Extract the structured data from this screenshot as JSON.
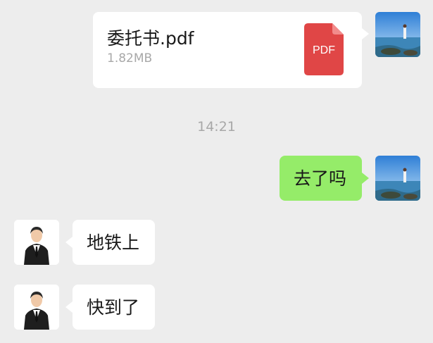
{
  "chat": {
    "messages": [
      {
        "sender": "me",
        "type": "file",
        "file_name": "委托书.pdf",
        "file_size": "1.82MB",
        "file_type_label": "PDF"
      },
      {
        "type": "timestamp",
        "text": "14:21"
      },
      {
        "sender": "me",
        "type": "text",
        "text": "去了吗"
      },
      {
        "sender": "contact",
        "type": "text",
        "text": "地铁上"
      },
      {
        "sender": "contact",
        "type": "text",
        "text": "快到了"
      }
    ]
  },
  "colors": {
    "background": "#ededed",
    "bubble_incoming": "#ffffff",
    "bubble_outgoing": "#95ec69",
    "pdf_icon": "#e04646",
    "meta_text": "#a8a8a8"
  },
  "icons": {
    "my_avatar": "beach-photo-avatar",
    "contact_avatar": "businessman-cartoon-avatar",
    "file_icon": "pdf-file-icon"
  }
}
